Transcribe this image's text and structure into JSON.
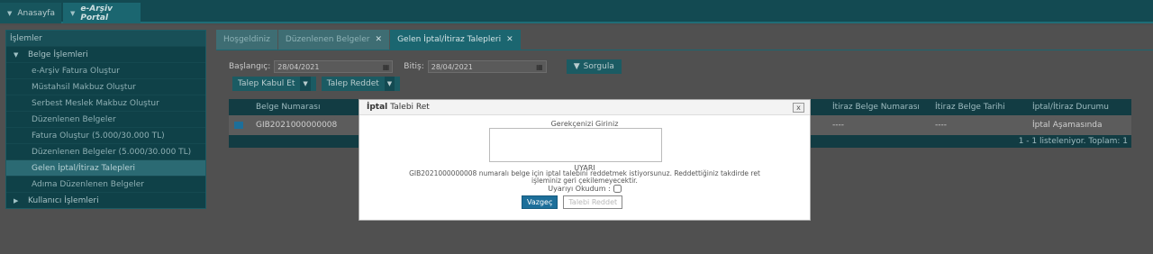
{
  "topnav": {
    "home": "Anasayfa",
    "portal": "e-Arşiv Portal"
  },
  "sidebar": {
    "header": "İşlemler",
    "group1": "Belge İşlemleri",
    "items": [
      "e-Arşiv Fatura Oluştur",
      "Müstahsil Makbuz Oluştur",
      "Serbest Meslek Makbuz Oluştur",
      "Düzenlenen Belgeler",
      "Fatura Oluştur (5.000/30.000 TL)",
      "Düzenlenen Belgeler (5.000/30.000 TL)",
      "Gelen İptal/İtiraz Talepleri",
      "Adıma Düzenlenen Belgeler"
    ],
    "group2": "Kullanıcı İşlemleri"
  },
  "tabs": [
    {
      "label": "Hoşgeldiniz"
    },
    {
      "label": "Düzenlenen Belgeler"
    },
    {
      "label": "Gelen İptal/İtiraz Talepleri"
    }
  ],
  "filters": {
    "start_label": "Başlangıç:",
    "start_value": "28/04/2021",
    "end_label": "Bitiş:",
    "end_value": "28/04/2021",
    "query_label": "Sorgula"
  },
  "actions": {
    "accept": "Talep Kabul Et",
    "reject": "Talep Reddet"
  },
  "grid": {
    "columns": [
      "Belge Numarası",
      "İtiraz Belge Numarası",
      "İtiraz Belge Tarihi",
      "İptal/İtiraz Durumu"
    ],
    "row": {
      "doc_no": "GIB2021000000008",
      "itiraz_no": "----",
      "itiraz_date": "----",
      "status": "İptal Aşamasında"
    },
    "footer": "1 - 1 listeleniyor. Toplam: 1"
  },
  "modal": {
    "title_bold": "İptal",
    "title_rest": "Talebi Ret",
    "close": "x",
    "prompt": "Gerekçenizi Giriniz",
    "reason_value": "",
    "warn_title": "UYARI",
    "warn_text_1": "GIB2021000000008 numaralı belge için iptal talebini reddetmek istiyorsunuz. Reddettiğiniz takdirde ret",
    "warn_text_2": "işleminiz geri çekilemeyecektir.",
    "ack_label": "Uyarıyı Okudum :",
    "cancel": "Vazgeç",
    "reject": "Talebi Reddet"
  }
}
